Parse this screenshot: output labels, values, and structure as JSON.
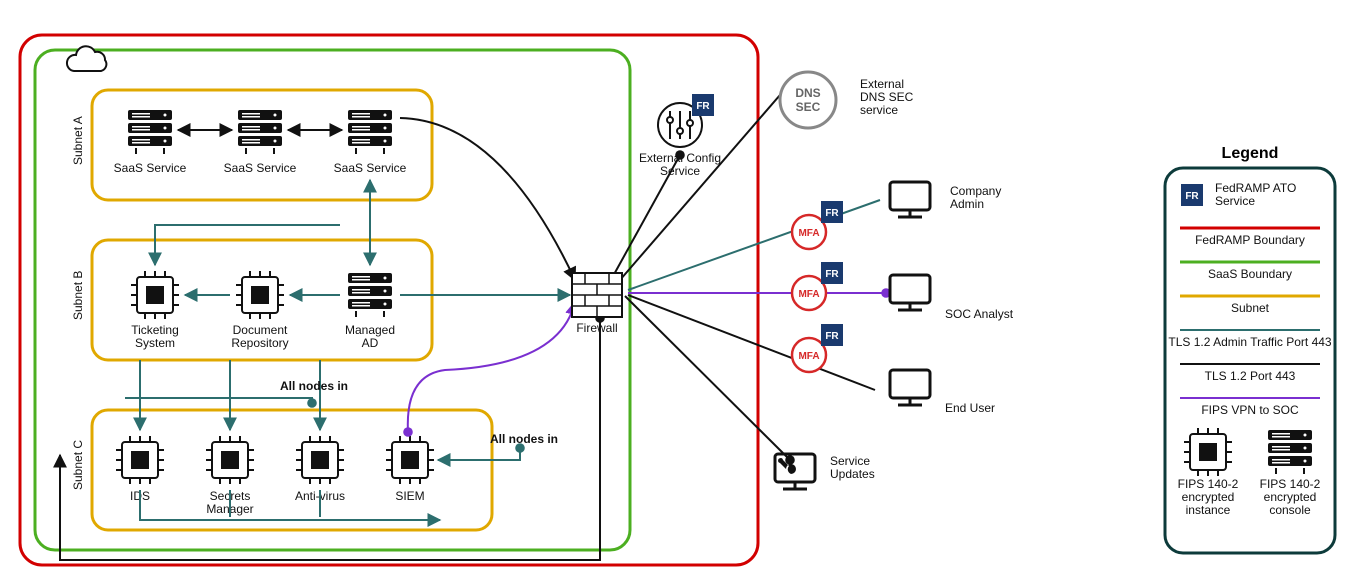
{
  "subnetA": {
    "label": "Subnet A",
    "n1": "SaaS Service",
    "n2": "SaaS Service",
    "n3": "SaaS Service"
  },
  "subnetB": {
    "label": "Subnet B",
    "n1": "Ticketing\nSystem",
    "n2": "Document\nRepository",
    "n3": "Managed\nAD"
  },
  "subnetC": {
    "label": "Subnet C",
    "n1": "IDS",
    "n2": "Secrets\nManager",
    "n3": "Anti-virus",
    "n4": "SIEM",
    "allnodes": "All nodes in"
  },
  "firewall": "Firewall",
  "externalConfig": "External Config\nService",
  "dnssec": {
    "badge": "DNS\nSEC",
    "label": "External\nDNS SEC\nservice"
  },
  "mfa": "MFA",
  "companyAdmin": "Company\nAdmin",
  "socAnalyst": "SOC Analyst",
  "endUser": "End User",
  "serviceUpdates": "Service\nUpdates",
  "fr": "FR",
  "legend": {
    "title": "Legend",
    "fedrampATO": "FedRAMP ATO\nService",
    "fedrampBoundary": "FedRAMP Boundary",
    "saasBoundary": "SaaS Boundary",
    "subnet": "Subnet",
    "tlsAdmin": "TLS 1.2 Admin Traffic Port 443",
    "tls": "TLS 1.2 Port 443",
    "fips": "FIPS VPN to SOC",
    "instance": "FIPS 140-2\nencrypted\ninstance",
    "console": "FIPS 140-2\nencrypted\nconsole"
  }
}
